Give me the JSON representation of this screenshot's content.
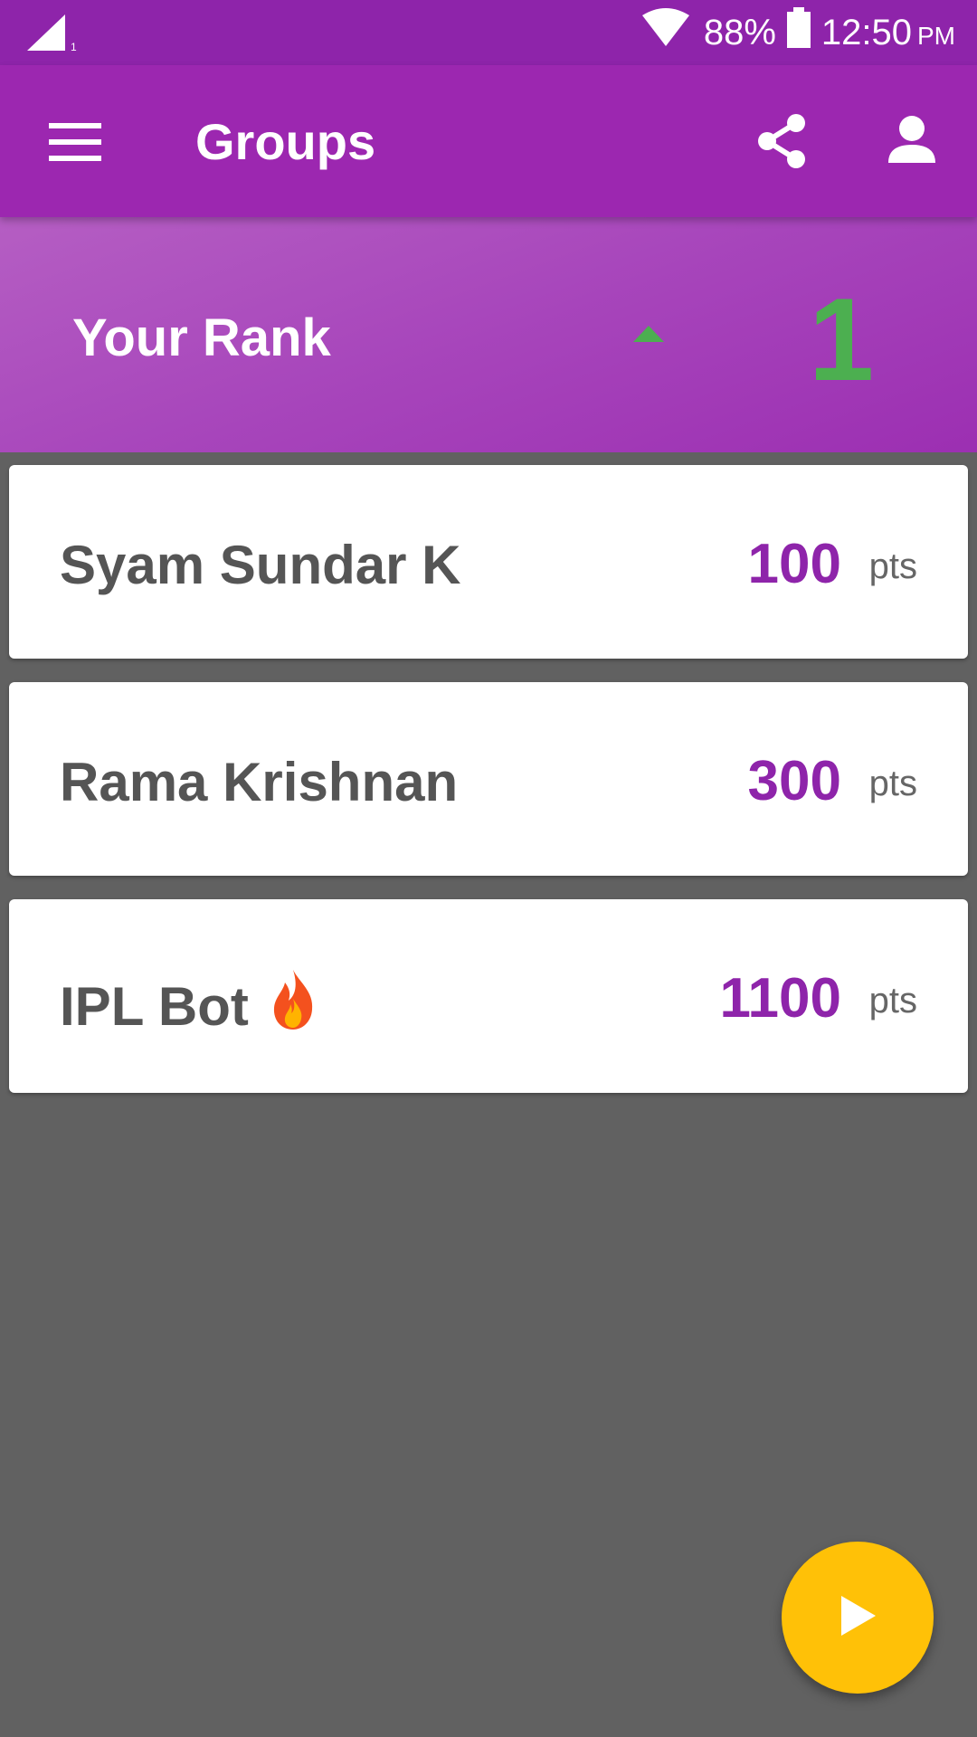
{
  "status_bar": {
    "signal_icon": "cellular-signal-icon",
    "wifi_icon": "wifi-icon",
    "battery_percent": "88%",
    "battery_icon": "battery-icon",
    "time": "12:50",
    "ampm": "PM"
  },
  "app_bar": {
    "menu_icon": "hamburger-menu-icon",
    "title": "Groups",
    "share_icon": "share-icon",
    "account_icon": "account-icon"
  },
  "rank": {
    "label": "Your Rank",
    "trend_icon": "arrow-up-icon",
    "value": "1",
    "value_color": "#4caf50"
  },
  "members": [
    {
      "name": "Syam Sundar K",
      "score": "100",
      "unit": "pts"
    },
    {
      "name": "Rama Krishnan",
      "score": "300",
      "unit": "pts"
    },
    {
      "name": "IPL Bot",
      "badge_icon": "fire-icon",
      "score": "1100",
      "unit": "pts"
    }
  ],
  "fab": {
    "icon": "play-icon",
    "color": "#ffc107"
  },
  "colors": {
    "primary": "#9c27b0",
    "primary_dark": "#8e24aa",
    "score": "#8e24aa",
    "background": "#616161"
  }
}
